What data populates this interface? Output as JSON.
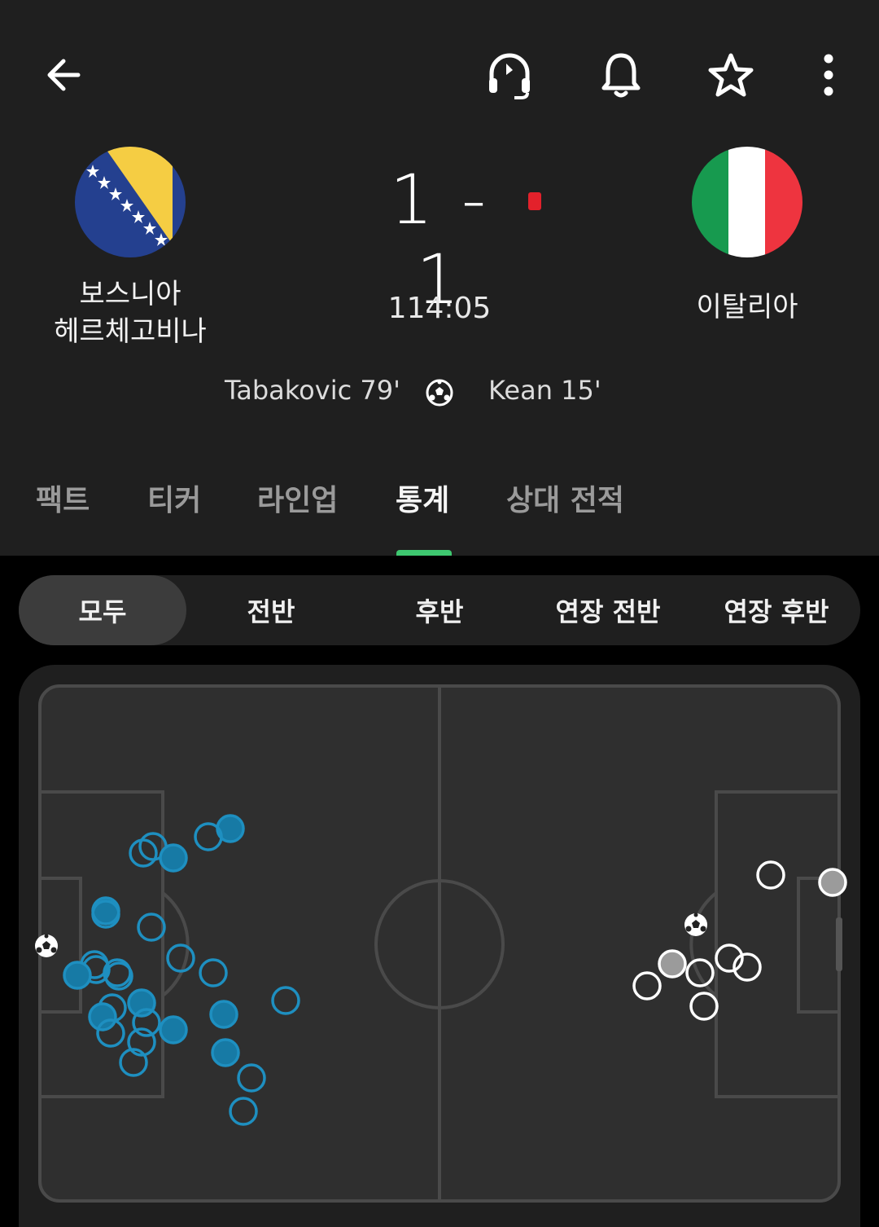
{
  "header": {
    "icons": [
      "back-arrow-icon",
      "headset-icon",
      "bell-icon",
      "star-icon",
      "more-vert-icon"
    ]
  },
  "match": {
    "home": {
      "name_line1": "보스니아",
      "name_line2": "헤르체고비나",
      "flag": "bosnia-herzegovina-flag"
    },
    "away": {
      "name": "이탈리아",
      "flag": "italy-flag"
    },
    "score": "1 - 1",
    "clock": "114:05",
    "home_scorer": "Tabakovic 79'",
    "away_scorer": "Kean 15'",
    "red_card_color": "#e3212b"
  },
  "tabs": [
    "팩트",
    "티커",
    "라인업",
    "통계",
    "상대 전적"
  ],
  "active_tab": "통계",
  "periods": [
    "모두",
    "전반",
    "후반",
    "연장 전반",
    "연장 후반"
  ],
  "active_period": "모두",
  "colors": {
    "home_shots": "#1e8fc0",
    "away_shots": "#ffffff",
    "accent": "#3ec870",
    "pitch": "#2f2f2f"
  }
}
